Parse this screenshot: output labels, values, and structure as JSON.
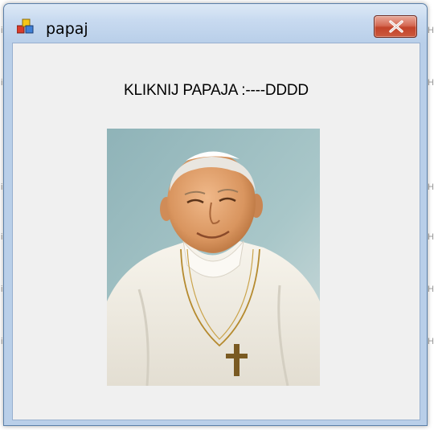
{
  "window": {
    "title": "papaj",
    "app_icon": "application-form-icon",
    "close_icon": "close-x-icon",
    "close_button_color": "#c9452d",
    "frame_color": "#b9cfe9",
    "client_background": "#f0f0f0"
  },
  "form": {
    "label_text": "KLIKNIJ PAPAJA :----DDDD",
    "picture_icon": "portrait-photo"
  }
}
